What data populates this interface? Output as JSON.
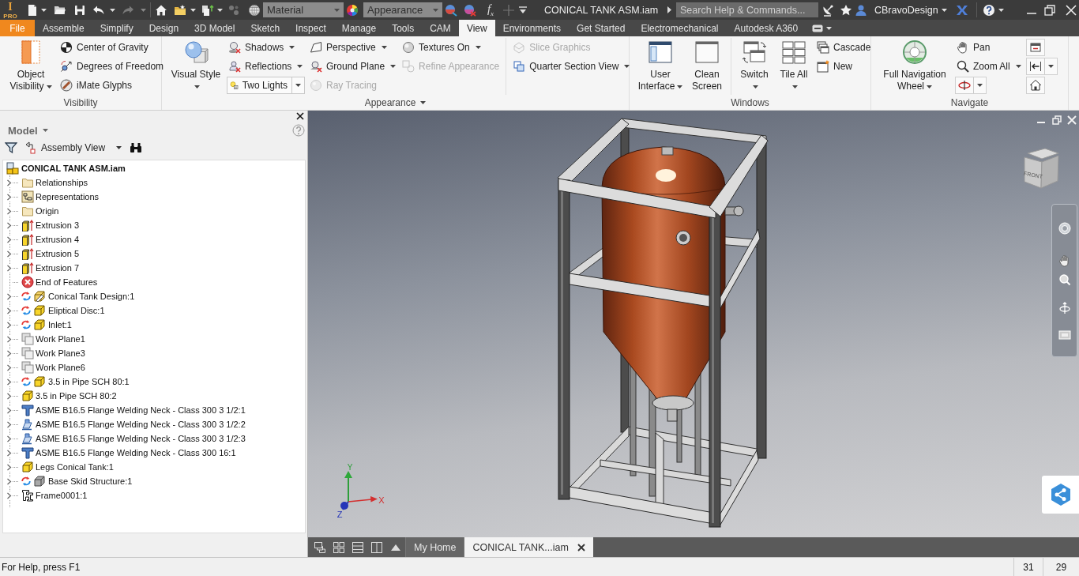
{
  "title_bar": {
    "logo": {
      "letter": "I",
      "edition": "PRO"
    },
    "material_combo": {
      "value": "Material",
      "disabled": true
    },
    "appearance_combo": {
      "value": "Appearance",
      "disabled": true
    },
    "formula_button": "f$_{x}$",
    "document_title": "CONICAL TANK ASM.iam",
    "search": {
      "placeholder": "Search Help & Commands..."
    },
    "user": "CBravoDesign"
  },
  "ribbon_tabs": [
    {
      "label": "File",
      "kind": "file",
      "selected": false
    },
    {
      "label": "Assemble",
      "kind": "tab",
      "selected": false
    },
    {
      "label": "Simplify",
      "kind": "tab",
      "selected": false
    },
    {
      "label": "Design",
      "kind": "tab",
      "selected": false
    },
    {
      "label": "3D Model",
      "kind": "tab",
      "selected": false
    },
    {
      "label": "Sketch",
      "kind": "tab",
      "selected": false
    },
    {
      "label": "Inspect",
      "kind": "tab",
      "selected": false
    },
    {
      "label": "Manage",
      "kind": "tab",
      "selected": false
    },
    {
      "label": "Tools",
      "kind": "tab",
      "selected": false
    },
    {
      "label": "CAM",
      "kind": "tab",
      "selected": false
    },
    {
      "label": "View",
      "kind": "tab",
      "selected": true
    },
    {
      "label": "Environments",
      "kind": "tab",
      "selected": false
    },
    {
      "label": "Get Started",
      "kind": "tab",
      "selected": false
    },
    {
      "label": "Electromechanical",
      "kind": "tab",
      "selected": false
    },
    {
      "label": "Autodesk A360",
      "kind": "tab",
      "selected": false
    }
  ],
  "ribbon_panels": [
    {
      "title": "Visibility",
      "dropdown": false,
      "sections": [
        {
          "columns": [
            [
              {
                "label": "Object Visibility",
                "kind": "large",
                "dropdown": true,
                "disabled": false
              }
            ],
            [
              {
                "label": "Center of Gravity",
                "kind": "small",
                "dropdown": false,
                "disabled": false
              },
              {
                "label": "Degrees of Freedom",
                "kind": "small",
                "dropdown": false,
                "disabled": false
              },
              {
                "label": "iMate Glyphs",
                "kind": "small",
                "dropdown": false,
                "disabled": false
              }
            ]
          ]
        }
      ]
    },
    {
      "title": "Appearance",
      "dropdown": true,
      "sections": [
        {
          "columns": [
            [
              {
                "label": "Visual Style",
                "kind": "large",
                "dropdown": true,
                "disabled": false
              }
            ],
            [
              {
                "label": "Shadows",
                "kind": "small",
                "dropdown": true,
                "disabled": false
              },
              {
                "label": "Reflections",
                "kind": "small",
                "dropdown": true,
                "disabled": false
              },
              {
                "label": "Two Lights",
                "kind": "combo",
                "dropdown": true,
                "disabled": false
              }
            ],
            [
              {
                "label": "Perspective",
                "kind": "small",
                "dropdown": true,
                "disabled": false
              },
              {
                "label": "Ground Plane",
                "kind": "small",
                "dropdown": true,
                "disabled": false
              },
              {
                "label": "Ray Tracing",
                "kind": "small",
                "dropdown": false,
                "disabled": true
              }
            ],
            [
              {
                "label": "Textures On",
                "kind": "small",
                "dropdown": true,
                "disabled": false
              },
              {
                "label": "Refine Appearance",
                "kind": "small",
                "dropdown": false,
                "disabled": true
              }
            ]
          ]
        },
        {
          "columns": [
            [
              {
                "label": "Slice Graphics",
                "kind": "small",
                "dropdown": false,
                "disabled": true
              },
              {
                "label": "Quarter Section View",
                "kind": "small",
                "dropdown": true,
                "disabled": false
              }
            ]
          ]
        }
      ]
    },
    {
      "title": "Windows",
      "dropdown": false,
      "sections": [
        {
          "columns": [
            [
              {
                "label": "User Interface",
                "kind": "large",
                "dropdown": true,
                "disabled": false
              }
            ],
            [
              {
                "label": "Clean Screen",
                "kind": "large",
                "dropdown": false,
                "disabled": false
              }
            ]
          ]
        },
        {
          "columns": [
            [
              {
                "label": "Switch",
                "kind": "large",
                "dropdown": true,
                "disabled": false
              }
            ],
            [
              {
                "label": "Tile All",
                "kind": "large",
                "dropdown": true,
                "disabled": false
              }
            ],
            [
              {
                "label": "Cascade",
                "kind": "small",
                "dropdown": false,
                "disabled": false
              },
              {
                "label": "New",
                "kind": "small",
                "dropdown": false,
                "disabled": false
              }
            ]
          ]
        }
      ]
    },
    {
      "title": "Navigate",
      "dropdown": false,
      "sections": [
        {
          "columns": [
            [
              {
                "label": "Full Navigation Wheel",
                "kind": "large",
                "dropdown": true,
                "disabled": false
              }
            ],
            [
              {
                "label": "Pan",
                "kind": "small",
                "dropdown": false,
                "disabled": false
              },
              {
                "label": "Zoom All",
                "kind": "small",
                "dropdown": true,
                "disabled": false
              },
              {
                "kind": "icon",
                "dropdown": true,
                "disabled": false
              }
            ],
            [
              {
                "kind": "icon",
                "dropdown": false,
                "disabled": false
              },
              {
                "kind": "icon",
                "dropdown": true,
                "disabled": false
              },
              {
                "kind": "icon",
                "dropdown": false,
                "disabled": false
              }
            ]
          ]
        }
      ]
    }
  ],
  "model_browser": {
    "title": "Model",
    "view": "Assembly View",
    "tree": {
      "label": "CONICAL TANK ASM.iam",
      "children": [
        {
          "label": "Relationships",
          "kind": "folder",
          "adaptive": false,
          "expanded": false
        },
        {
          "label": "Representations",
          "kind": "representations",
          "adaptive": false,
          "expanded": false
        },
        {
          "label": "Origin",
          "kind": "folder",
          "adaptive": false,
          "expanded": false
        },
        {
          "label": "Extrusion 3",
          "kind": "extrusion",
          "adaptive": false,
          "expanded": false
        },
        {
          "label": "Extrusion 4",
          "kind": "extrusion",
          "adaptive": false,
          "expanded": false
        },
        {
          "label": "Extrusion 5",
          "kind": "extrusion",
          "adaptive": false,
          "expanded": false
        },
        {
          "label": "Extrusion 7",
          "kind": "extrusion",
          "adaptive": false,
          "expanded": false
        },
        {
          "label": "End of Features",
          "kind": "end",
          "adaptive": false
        },
        {
          "label": "Conical Tank Design:1",
          "kind": "design",
          "adaptive": true,
          "expanded": false
        },
        {
          "label": "Eliptical Disc:1",
          "kind": "part",
          "adaptive": true,
          "expanded": false
        },
        {
          "label": "Inlet:1",
          "kind": "part",
          "adaptive": true,
          "expanded": false
        },
        {
          "label": "Work Plane1",
          "kind": "workplane",
          "adaptive": false,
          "expanded": false
        },
        {
          "label": "Work Plane3",
          "kind": "workplane",
          "adaptive": false,
          "expanded": false
        },
        {
          "label": "Work Plane6",
          "kind": "workplane",
          "adaptive": false,
          "expanded": false
        },
        {
          "label": "3.5 in Pipe SCH 80:1",
          "kind": "part",
          "adaptive": true,
          "expanded": false
        },
        {
          "label": "3.5 in Pipe SCH 80:2",
          "kind": "part",
          "adaptive": false,
          "expanded": false
        },
        {
          "label": "ASME B16.5 Flange Welding Neck - Class 300 3 1/2:1",
          "kind": "flange_tee",
          "adaptive": false,
          "expanded": false
        },
        {
          "label": "ASME B16.5 Flange Welding Neck - Class 300 3 1/2:2",
          "kind": "flange_plate",
          "adaptive": false,
          "expanded": false
        },
        {
          "label": "ASME B16.5 Flange Welding Neck - Class 300 3 1/2:3",
          "kind": "flange_plate",
          "adaptive": false,
          "expanded": false
        },
        {
          "label": "ASME B16.5 Flange Welding Neck - Class 300 16:1",
          "kind": "flange_tee",
          "adaptive": false,
          "expanded": false
        },
        {
          "label": "Legs Conical Tank:1",
          "kind": "part",
          "adaptive": false,
          "expanded": false
        },
        {
          "label": "Base Skid Structure:1",
          "kind": "weldment",
          "adaptive": true,
          "expanded": false
        },
        {
          "label": "Frame0001:1",
          "kind": "frame",
          "adaptive": false,
          "expanded": false
        }
      ]
    }
  },
  "viewport": {
    "view_cube": {
      "front": "FRONT"
    },
    "triad": {
      "x": "X",
      "y": "Y",
      "z": "Z"
    }
  },
  "document_tabs": [
    {
      "label": "My Home",
      "selected": false
    },
    {
      "label": "CONICAL TANK...iam",
      "selected": true
    }
  ],
  "status_bar": {
    "message": "For Help, press F1",
    "fields": [
      "31",
      "29"
    ]
  }
}
